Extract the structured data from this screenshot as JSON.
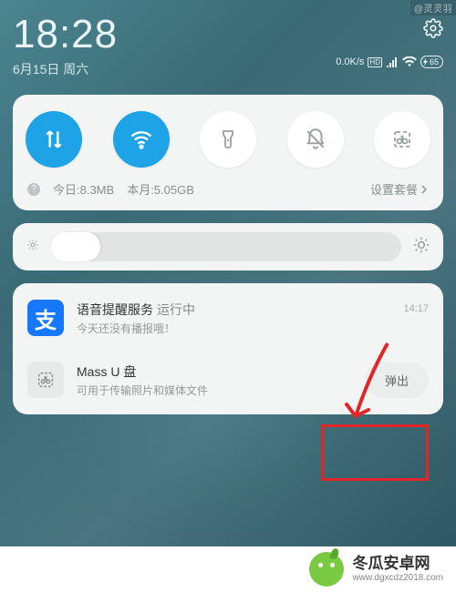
{
  "header": {
    "time": "18:28",
    "date": "6月15日 周六",
    "status": {
      "speed": "0.0K/s",
      "hd": "HD",
      "battery": "65"
    }
  },
  "toggles": {
    "data": "mobile-data",
    "wifi": "wifi",
    "torch": "flashlight",
    "dnd": "do-not-disturb",
    "screenshot": "screenshot"
  },
  "usage": {
    "today_label": "今日:8.3MB",
    "month_label": "本月:5.05GB",
    "plan_label": "设置套餐"
  },
  "notifications": [
    {
      "icon": "支",
      "title": "语音提醒服务",
      "status": "运行中",
      "sub": "今天还没有播报哦！",
      "time": "14:17"
    },
    {
      "title": "Mass U 盘",
      "sub": "可用于传输照片和媒体文件",
      "action": "弹出"
    }
  ],
  "brand": {
    "name": "冬瓜安卓网",
    "url": "www.dgxcdz2018.com"
  },
  "watermark": "@灵灵羽"
}
